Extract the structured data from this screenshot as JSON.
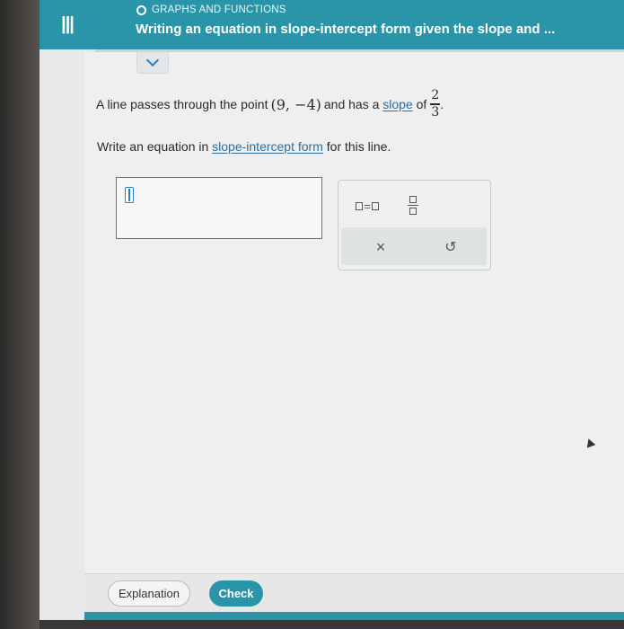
{
  "header": {
    "menu_icon": "hamburger-menu-icon",
    "topic": "GRAPHS AND FUNCTIONS",
    "title": "Writing an equation in slope-intercept form given the slope and ..."
  },
  "problem": {
    "text_before": "A line passes through the point",
    "point": "(9, −4)",
    "text_middle": "and has a",
    "slope_link": "slope",
    "text_of": "of",
    "slope_numerator": "2",
    "slope_denominator": "3",
    "text_end": "."
  },
  "prompt": {
    "text_before": "Write an equation in",
    "link": "slope-intercept form",
    "text_after": "for this line."
  },
  "answer": {
    "value": ""
  },
  "keypad": {
    "equals_key": "=",
    "clear_key": "×",
    "undo_key": "↺"
  },
  "footer": {
    "explanation_label": "Explanation",
    "check_label": "Check"
  },
  "colors": {
    "teal": "#2a95a8",
    "link_blue": "#2a6fa8"
  }
}
